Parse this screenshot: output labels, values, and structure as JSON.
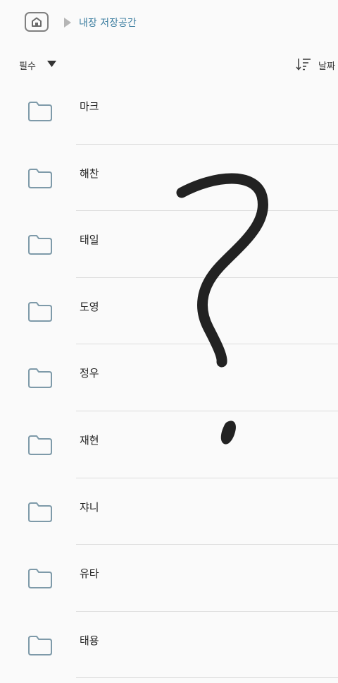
{
  "breadcrumb": {
    "home_icon": "home-icon",
    "separator_icon": "play-arrow-icon",
    "current": "내장 저장공간"
  },
  "toolbar": {
    "filter_label": "필수",
    "filter_icon": "caret-down-icon",
    "sort_icon": "sort-descending-icon",
    "sort_label": "날짜"
  },
  "folders": [
    {
      "name": "마크"
    },
    {
      "name": "해찬"
    },
    {
      "name": "태일"
    },
    {
      "name": "도영"
    },
    {
      "name": "정우"
    },
    {
      "name": "재현"
    },
    {
      "name": "쟈니"
    },
    {
      "name": "유타"
    },
    {
      "name": "태용"
    }
  ],
  "colors": {
    "background": "#fafafa",
    "accent": "#3d7ea0",
    "icon_outline": "#7e9aa9",
    "overlay_stroke": "#222222"
  }
}
